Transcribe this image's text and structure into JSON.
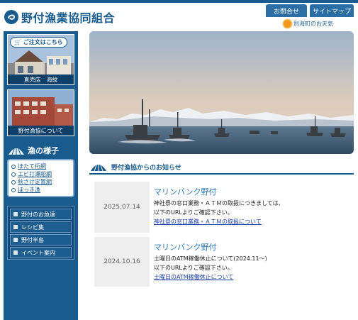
{
  "header": {
    "site_title": "野付漁業協同組合",
    "contact_label": "お問合せ",
    "sitemap_label": "サイトマップ",
    "weather_label": "別海町のお天気"
  },
  "sidebar": {
    "order_label": "ご注文はこちら",
    "banner1_caption": "直売店　海紋",
    "banner2_caption": "野付漁協について",
    "section_title": "漁の様子",
    "links": [
      "ほたて桁網",
      "エビ打瀬船網",
      "秋さけ定置網",
      "ほっき漁"
    ],
    "menu": [
      "野付のお魚達",
      "レシピ集",
      "野付半島",
      "イベント案内"
    ]
  },
  "news": {
    "title": "野付漁協からのお知らせ",
    "items": [
      {
        "date": "2025.07.14",
        "name": "マリンバンク野付",
        "line1": "神社祭の窓口業務・ＡＴＭの取扱につきましては、",
        "line2": "以下のURLよりご確認下さい。",
        "link": "神社祭の窓口業務・ＡＴＭの取扱について"
      },
      {
        "date": "2024.10.16",
        "name": "マリンバンク野付",
        "line1": "土曜日のATM稼働休止について(2024.11～)",
        "line2": "以下のURLよりご確認下さい。",
        "link": "土曜日のATM稼働休止について"
      }
    ]
  },
  "colors": {
    "primary": "#1a5b8e",
    "accent_link": "#2a79b8",
    "sun": "#f39a1e"
  }
}
